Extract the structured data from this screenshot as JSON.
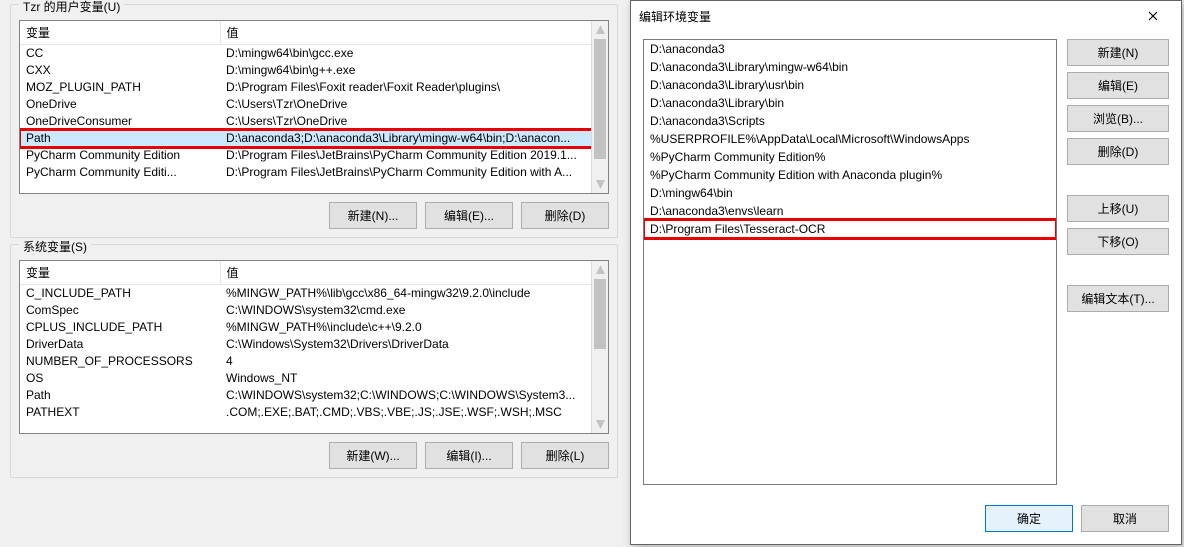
{
  "left": {
    "user_vars_title": "Tzr 的用户变量(U)",
    "system_vars_title": "系统变量(S)",
    "headers": {
      "var": "变量",
      "val": "值"
    },
    "user_rows": [
      {
        "var": "CC",
        "val": "D:\\mingw64\\bin\\gcc.exe"
      },
      {
        "var": "CXX",
        "val": "D:\\mingw64\\bin\\g++.exe"
      },
      {
        "var": "MOZ_PLUGIN_PATH",
        "val": "D:\\Program Files\\Foxit reader\\Foxit Reader\\plugins\\"
      },
      {
        "var": "OneDrive",
        "val": "C:\\Users\\Tzr\\OneDrive"
      },
      {
        "var": "OneDriveConsumer",
        "val": "C:\\Users\\Tzr\\OneDrive"
      },
      {
        "var": "Path",
        "val": "D:\\anaconda3;D:\\anaconda3\\Library\\mingw-w64\\bin;D:\\anacon...",
        "boxred": true,
        "selected": true
      },
      {
        "var": "PyCharm Community Edition",
        "val": "D:\\Program Files\\JetBrains\\PyCharm Community Edition 2019.1..."
      },
      {
        "var": "PyCharm Community Editi...",
        "val": "D:\\Program Files\\JetBrains\\PyCharm Community Edition with A..."
      }
    ],
    "system_rows": [
      {
        "var": "C_INCLUDE_PATH",
        "val": "%MINGW_PATH%\\lib\\gcc\\x86_64-mingw32\\9.2.0\\include"
      },
      {
        "var": "ComSpec",
        "val": "C:\\WINDOWS\\system32\\cmd.exe"
      },
      {
        "var": "CPLUS_INCLUDE_PATH",
        "val": "%MINGW_PATH%\\include\\c++\\9.2.0"
      },
      {
        "var": "DriverData",
        "val": "C:\\Windows\\System32\\Drivers\\DriverData"
      },
      {
        "var": "NUMBER_OF_PROCESSORS",
        "val": "4"
      },
      {
        "var": "OS",
        "val": "Windows_NT"
      },
      {
        "var": "Path",
        "val": "C:\\WINDOWS\\system32;C:\\WINDOWS;C:\\WINDOWS\\System3..."
      },
      {
        "var": "PATHEXT",
        "val": ".COM;.EXE;.BAT;.CMD;.VBS;.VBE;.JS;.JSE;.WSF;.WSH;.MSC"
      }
    ],
    "btns_user": {
      "new": "新建(N)...",
      "edit": "编辑(E)...",
      "del": "删除(D)"
    },
    "btns_sys": {
      "new": "新建(W)...",
      "edit": "编辑(I)...",
      "del": "删除(L)"
    }
  },
  "dialog": {
    "title": "编辑环境变量",
    "entries": [
      {
        "text": "D:\\anaconda3"
      },
      {
        "text": "D:\\anaconda3\\Library\\mingw-w64\\bin"
      },
      {
        "text": "D:\\anaconda3\\Library\\usr\\bin"
      },
      {
        "text": "D:\\anaconda3\\Library\\bin"
      },
      {
        "text": "D:\\anaconda3\\Scripts"
      },
      {
        "text": "%USERPROFILE%\\AppData\\Local\\Microsoft\\WindowsApps"
      },
      {
        "text": "%PyCharm Community Edition%"
      },
      {
        "text": "%PyCharm Community Edition with Anaconda plugin%"
      },
      {
        "text": "D:\\mingw64\\bin"
      },
      {
        "text": "D:\\anaconda3\\envs\\learn"
      },
      {
        "text": "D:\\Program Files\\Tesseract-OCR",
        "boxred": true
      }
    ],
    "buttons": {
      "new": "新建(N)",
      "edit": "编辑(E)",
      "browse": "浏览(B)...",
      "del": "删除(D)",
      "up": "上移(U)",
      "down": "下移(O)",
      "edit_text": "编辑文本(T)...",
      "ok": "确定",
      "cancel": "取消"
    }
  }
}
